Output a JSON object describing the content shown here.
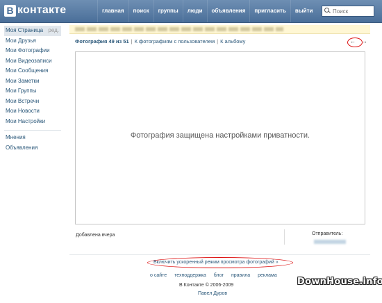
{
  "header": {
    "logo_letter": "В",
    "logo_text": "контакте",
    "nav": [
      "главная",
      "поиск",
      "группы",
      "люди",
      "объявления",
      "пригласить",
      "выйти"
    ],
    "search_placeholder": "Поиск"
  },
  "sidebar": {
    "items": [
      {
        "label": "Моя Страница",
        "edit": "ред."
      },
      {
        "label": "Мои Друзья"
      },
      {
        "label": "Мои Фотографии"
      },
      {
        "label": "Мои Видеозаписи"
      },
      {
        "label": "Мои Сообщения"
      },
      {
        "label": "Мои Заметки"
      },
      {
        "label": "Мои Группы"
      },
      {
        "label": "Мои Встречи"
      },
      {
        "label": "Мои Новости"
      },
      {
        "label": "Мои Настройки"
      }
    ],
    "extra": [
      {
        "label": "Мнения"
      },
      {
        "label": "Объявления"
      }
    ]
  },
  "photo": {
    "counter": "Фотография 49 из 51",
    "to_user_photos": "К фотографиям с пользователем",
    "to_album": "К альбому",
    "prev_arrow": "←",
    "next_arrow": "→",
    "private_message": "Фотография защищена настройками приватности.",
    "added": "Добавлена вчера",
    "sender_label": "Отправитель:"
  },
  "fast_view": "Включить ускоренный режим просмотра фотографий »",
  "footer": {
    "links": [
      "о сайте",
      "техподдержка",
      "блог",
      "правила",
      "реклама"
    ],
    "copyright": "В Контакте © 2006-2009",
    "author": "Павел Дуров"
  },
  "watermark": "DownHouse.info",
  "colors": {
    "header": "#4a6f99",
    "link": "#2b587a",
    "highlight": "#d11111"
  }
}
